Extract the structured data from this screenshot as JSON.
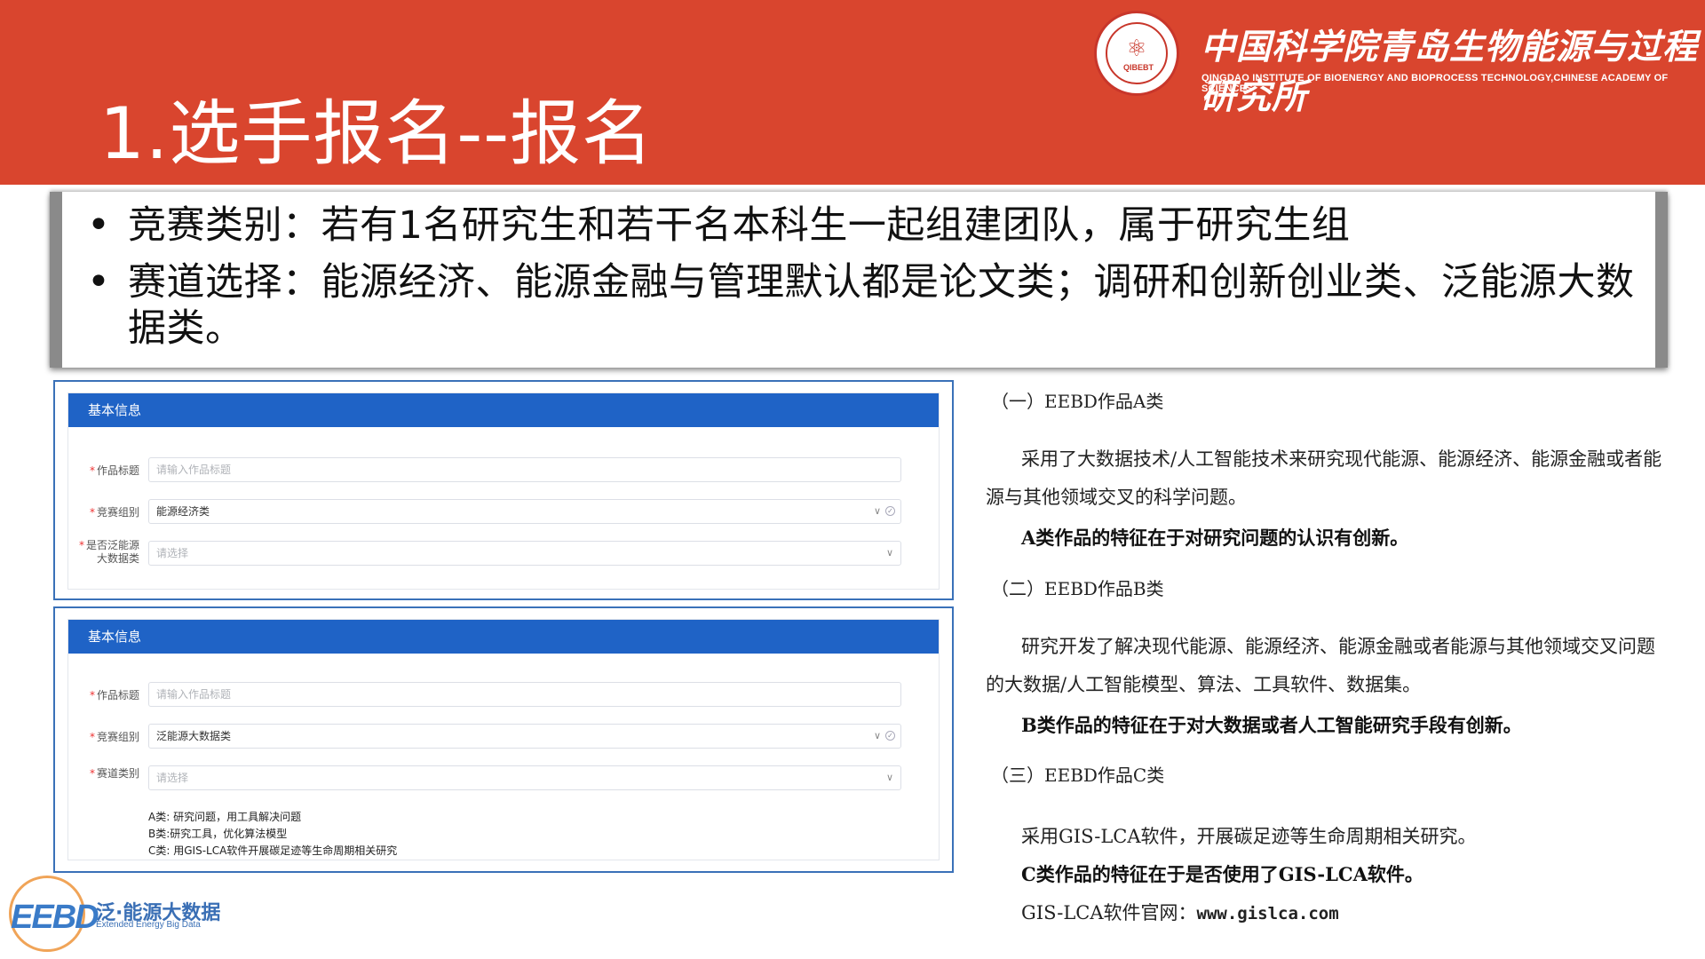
{
  "header": {
    "slide_title": "1.选手报名--报名",
    "org_cn": "中国科学院青岛生物能源与过程研究所",
    "org_en": "QINGDAO INSTITUTE OF BIOENERGY AND BIOPROCESS TECHNOLOGY,CHINESE ACADEMY OF SCIENCES",
    "seal_text": "QIBEBT"
  },
  "bullets": [
    "竞赛类别：若有1名研究生和若干名本科生一起组建团队，属于研究生组",
    "赛道选择：能源经济、能源金融与管理默认都是论文类；调研和创新创业类、泛能源大数",
    "据类。"
  ],
  "form1": {
    "header": "基本信息",
    "title_label": "作品标题",
    "title_placeholder": "请输入作品标题",
    "group_label": "竞赛组别",
    "group_value": "能源经济类",
    "bigdata_label_1": "是否泛能源",
    "bigdata_label_2": "大数据类",
    "bigdata_placeholder": "请选择"
  },
  "form2": {
    "header": "基本信息",
    "title_label": "作品标题",
    "title_placeholder": "请输入作品标题",
    "group_label": "竞赛组别",
    "group_value": "泛能源大数据类",
    "track_label": "赛道类别",
    "track_placeholder": "请选择",
    "notes": [
      "A类: 研究问题，用工具解决问题",
      "B类:研究工具，优化算法模型",
      "C类: 用GIS-LCA软件开展碳足迹等生命周期相关研究"
    ]
  },
  "descriptions": {
    "a_title": "（一）EEBD作品A类",
    "a_para": "采用了大数据技术/人工智能技术来研究现代能源、能源经济、能源金融或者能源与其他领域交叉的科学问题。",
    "a_bold": "A类作品的特征在于对研究问题的认识有创新。",
    "b_title": "（二）EEBD作品B类",
    "b_para": "研究开发了解决现代能源、能源经济、能源金融或者能源与其他领域交叉问题的大数据/人工智能模型、算法、工具软件、数据集。",
    "b_bold": "B类作品的特征在于对大数据或者人工智能研究手段有创新。",
    "c_title": "（三）EEBD作品C类",
    "c_line": "采用GIS-LCA软件，开展碳足迹等生命周期相关研究。",
    "c_bold": "C类作品的特征在于是否使用了GIS-LCA软件。",
    "site_label": "GIS-LCA软件官网：",
    "site_value": "www.gislca.com"
  },
  "logo": {
    "letters": "EEBD",
    "cn": "泛·能源大数据",
    "en": "Extended Energy Big Data"
  },
  "colors": {
    "header_bg": "#d9452e",
    "form_header": "#1f63c6",
    "panel_border": "#3a71b8"
  }
}
